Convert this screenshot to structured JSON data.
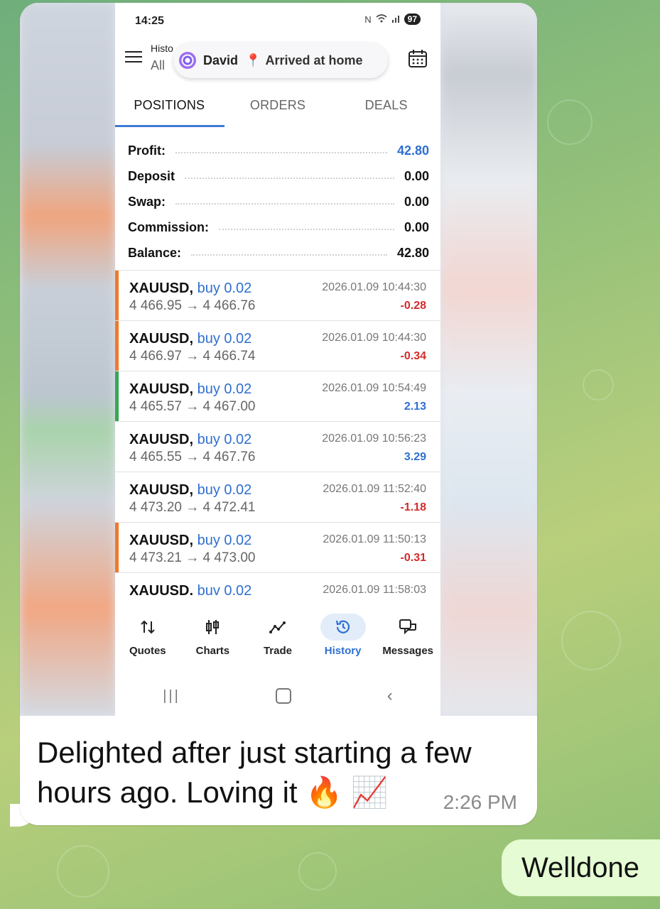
{
  "phone": {
    "status_time": "14:25",
    "battery": "97",
    "history_title": "Histo",
    "history_sub": "All",
    "notification": {
      "name": "David",
      "status": "Arrived at home"
    },
    "tabs": [
      "POSITIONS",
      "ORDERS",
      "DEALS"
    ],
    "summary": [
      {
        "label": "Profit:",
        "value": "42.80",
        "color": "#2f6fd1"
      },
      {
        "label": "Deposit",
        "value": "0.00"
      },
      {
        "label": "Swap:",
        "value": "0.00"
      },
      {
        "label": "Commission:",
        "value": "0.00"
      },
      {
        "label": "Balance:",
        "value": "42.80"
      }
    ],
    "deals": [
      {
        "symbol": "XAUUSD,",
        "side": "buy 0.02",
        "prices": "4 466.95 → 4 466.76",
        "time": "2026.01.09 10:44:30",
        "profit": "-0.28",
        "bar": "#f07a2a",
        "profit_color": "#d42b2b"
      },
      {
        "symbol": "XAUUSD,",
        "side": "buy 0.02",
        "prices": "4 466.97 → 4 466.74",
        "time": "2026.01.09 10:44:30",
        "profit": "-0.34",
        "bar": "#f07a2a",
        "profit_color": "#d42b2b"
      },
      {
        "symbol": "XAUUSD,",
        "side": "buy 0.02",
        "prices": "4 465.57 → 4 467.00",
        "time": "2026.01.09 10:54:49",
        "profit": "2.13",
        "bar": "#35a853",
        "profit_color": "#2f6fd1"
      },
      {
        "symbol": "XAUUSD,",
        "side": "buy 0.02",
        "prices": "4 465.55 → 4 467.76",
        "time": "2026.01.09 10:56:23",
        "profit": "3.29",
        "bar": "transparent",
        "profit_color": "#2f6fd1"
      },
      {
        "symbol": "XAUUSD,",
        "side": "buy 0.02",
        "prices": "4 473.20 → 4 472.41",
        "time": "2026.01.09 11:52:40",
        "profit": "-1.18",
        "bar": "transparent",
        "profit_color": "#d42b2b"
      },
      {
        "symbol": "XAUUSD,",
        "side": "buy 0.02",
        "prices": "4 473.21 → 4 473.00",
        "time": "2026.01.09 11:50:13",
        "profit": "-0.31",
        "bar": "#f07a2a",
        "profit_color": "#d42b2b"
      },
      {
        "symbol": "XAUUSD.",
        "side": "buv 0.02",
        "prices": "",
        "time": "2026.01.09 11:58:03",
        "profit": "",
        "bar": "transparent",
        "profit_color": "#d42b2b"
      }
    ],
    "bottom_nav": [
      {
        "label": "Quotes",
        "icon": "quotes-icon"
      },
      {
        "label": "Charts",
        "icon": "charts-icon"
      },
      {
        "label": "Trade",
        "icon": "trade-icon"
      },
      {
        "label": "History",
        "icon": "history-icon",
        "active": true
      },
      {
        "label": "Messages",
        "icon": "messages-icon"
      }
    ]
  },
  "message": {
    "caption_line1": "Delighted after just starting a few",
    "caption_line2": "hours ago. Loving it 🔥 📈",
    "time": "2:26 PM"
  },
  "reply": {
    "text": "Welldone"
  }
}
